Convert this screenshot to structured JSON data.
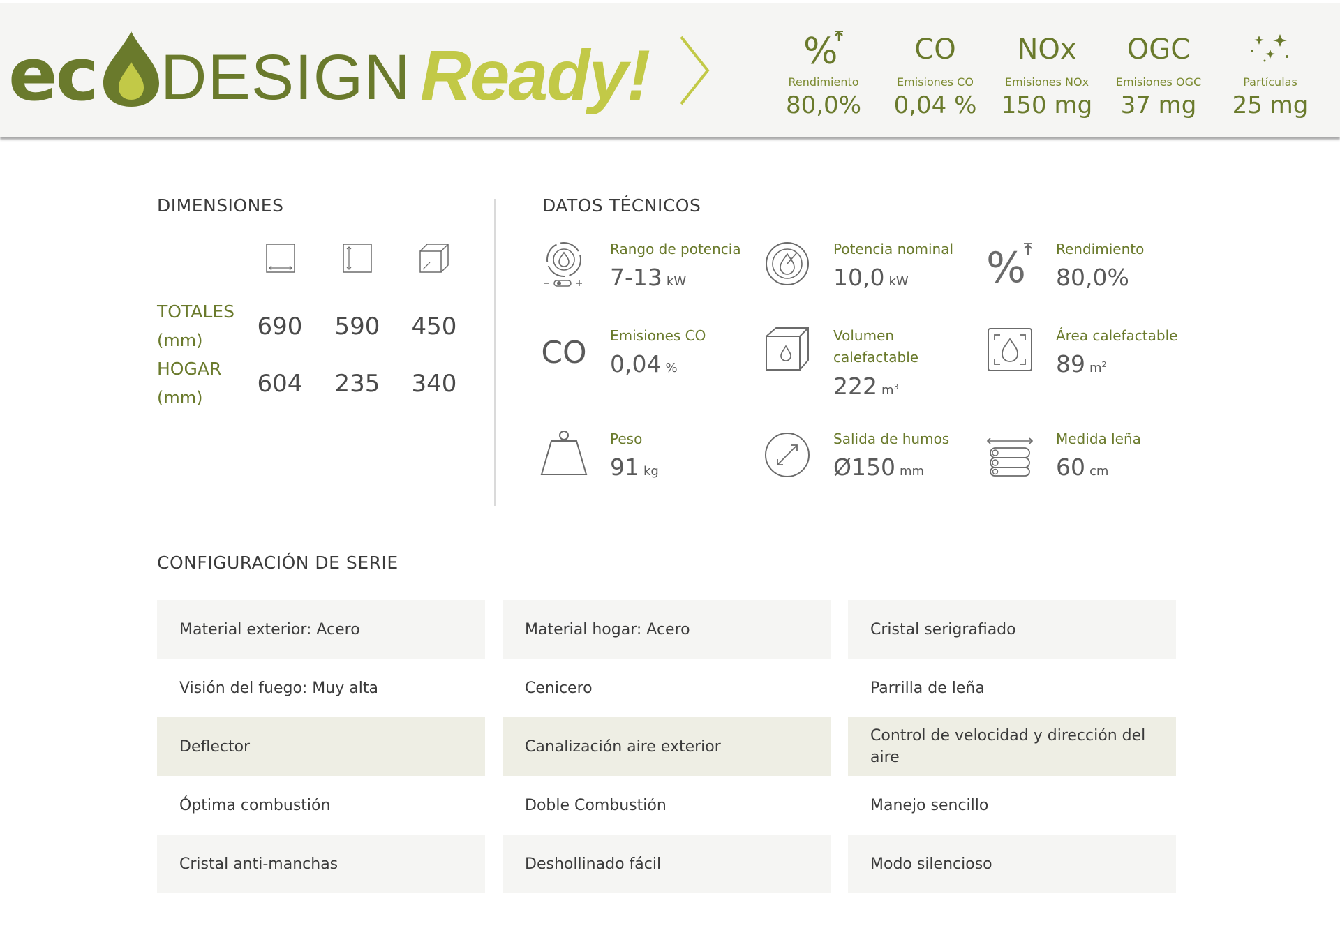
{
  "logo": {
    "eco": "ec",
    "design": "DESIGN",
    "ready": "Ready!"
  },
  "colors": {
    "olive": "#6a7a2c",
    "lime": "#c2c947",
    "banner_bg": "#f5f5f3",
    "beige": "#eeeee4"
  },
  "metrics": [
    {
      "symbol": "",
      "icon": "efficiency-percent-icon",
      "label": "Rendimiento",
      "value": "80,0%"
    },
    {
      "symbol": "CO",
      "icon": "",
      "label": "Emisiones CO",
      "value": "0,04 %"
    },
    {
      "symbol": "NOx",
      "icon": "",
      "label": "Emisiones NOx",
      "value": "150 mg"
    },
    {
      "symbol": "OGC",
      "icon": "",
      "label": "Emisiones OGC",
      "value": "37 mg"
    },
    {
      "symbol": "",
      "icon": "particles-stars-icon",
      "label": "Partículas",
      "value": "25 mg"
    }
  ],
  "dimensions": {
    "title": "DIMENSIONES",
    "icons": [
      "width-icon",
      "height-icon",
      "depth-icon"
    ],
    "rows": [
      {
        "label": "TOTALES",
        "unit": "(mm)",
        "values": [
          "690",
          "590",
          "450"
        ]
      },
      {
        "label": "HOGAR",
        "unit": "(mm)",
        "values": [
          "604",
          "235",
          "340"
        ]
      }
    ]
  },
  "tech": {
    "title": "DATOS TÉCNICOS",
    "items": [
      {
        "icon": "power-range-icon",
        "label": "Rango de potencia",
        "value": "7-13",
        "unit": "kW"
      },
      {
        "icon": "nominal-power-icon",
        "label": "Potencia nominal",
        "value": "10,0",
        "unit": "kW"
      },
      {
        "icon": "efficiency-percent-icon",
        "label": "Rendimiento",
        "value": "80,0%",
        "unit": ""
      },
      {
        "icon": "co-emissions-icon",
        "icon_text": "CO",
        "label": "Emisiones CO",
        "value": "0,04",
        "unit": "%"
      },
      {
        "icon": "heatable-volume-icon",
        "label": "Volumen calefactable",
        "value": "222",
        "unit": "m",
        "unit_sup": "3"
      },
      {
        "icon": "heatable-area-icon",
        "label": "Área calefactable",
        "value": "89",
        "unit": "m",
        "unit_sup": "2"
      },
      {
        "icon": "weight-icon",
        "label": "Peso",
        "value": "91",
        "unit": "kg"
      },
      {
        "icon": "flue-outlet-icon",
        "label": "Salida de humos",
        "value": "Ø150",
        "unit": "mm"
      },
      {
        "icon": "log-length-icon",
        "label": "Medida leña",
        "value": "60",
        "unit": "cm"
      }
    ]
  },
  "config": {
    "title": "CONFIGURACIÓN DE SERIE",
    "rows": [
      [
        "Material exterior: Acero",
        "Material hogar: Acero",
        "Cristal serigrafiado"
      ],
      [
        "Visión del fuego: Muy alta",
        "Cenicero",
        "Parrilla de leña"
      ],
      [
        "Deflector",
        "Canalización aire exterior",
        "Control de velocidad y dirección del aire"
      ],
      [
        "Óptima combustión",
        "Doble Combustión",
        "Manejo sencillo"
      ],
      [
        "Cristal anti-manchas",
        "Deshollinado fácil",
        "Modo silencioso"
      ]
    ]
  }
}
